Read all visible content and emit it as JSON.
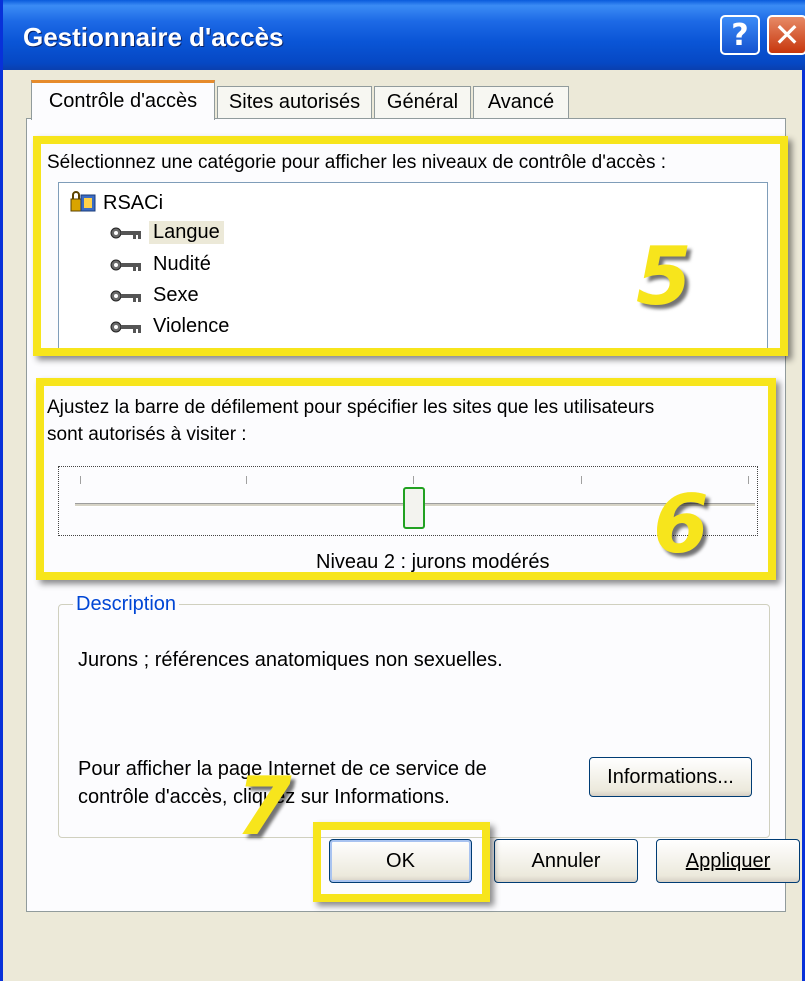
{
  "window": {
    "title": "Gestionnaire d'accès",
    "help_glyph": "?",
    "close_glyph": "✕"
  },
  "tabs": [
    {
      "label": "Contrôle d'accès",
      "active": true
    },
    {
      "label": "Sites autorisés",
      "active": false
    },
    {
      "label": "Général",
      "active": false
    },
    {
      "label": "Avancé",
      "active": false
    }
  ],
  "category": {
    "prompt": "Sélectionnez une catégorie pour afficher les niveaux de contrôle d'accès :",
    "tree": {
      "root": "RSACi",
      "root_icon": "lock-shield-icon",
      "item_icon": "key-icon",
      "items": [
        "Langue",
        "Nudité",
        "Sexe",
        "Violence"
      ],
      "selected": "Langue"
    }
  },
  "slider": {
    "prompt_line1": "Ajustez la barre de défilement pour spécifier les sites que les utilisateurs",
    "prompt_line2": "sont autorisés à visiter :",
    "level_text": "Niveau 2 : jurons modérés",
    "level_index": 2,
    "level_count": 5
  },
  "description": {
    "legend": "Description",
    "text": "Jurons ; références anatomiques non sexuelles.",
    "info_line1": "Pour afficher la page Internet de ce service de",
    "info_line2": "contrôle d'accès, cliquez sur Informations.",
    "info_button": "Informations..."
  },
  "buttons": {
    "ok": "OK",
    "cancel": "Annuler",
    "apply": "Appliquer"
  },
  "annotations": {
    "n5": "5",
    "n6": "6",
    "n7": "7",
    "highlight_color": "#f7e51c"
  }
}
